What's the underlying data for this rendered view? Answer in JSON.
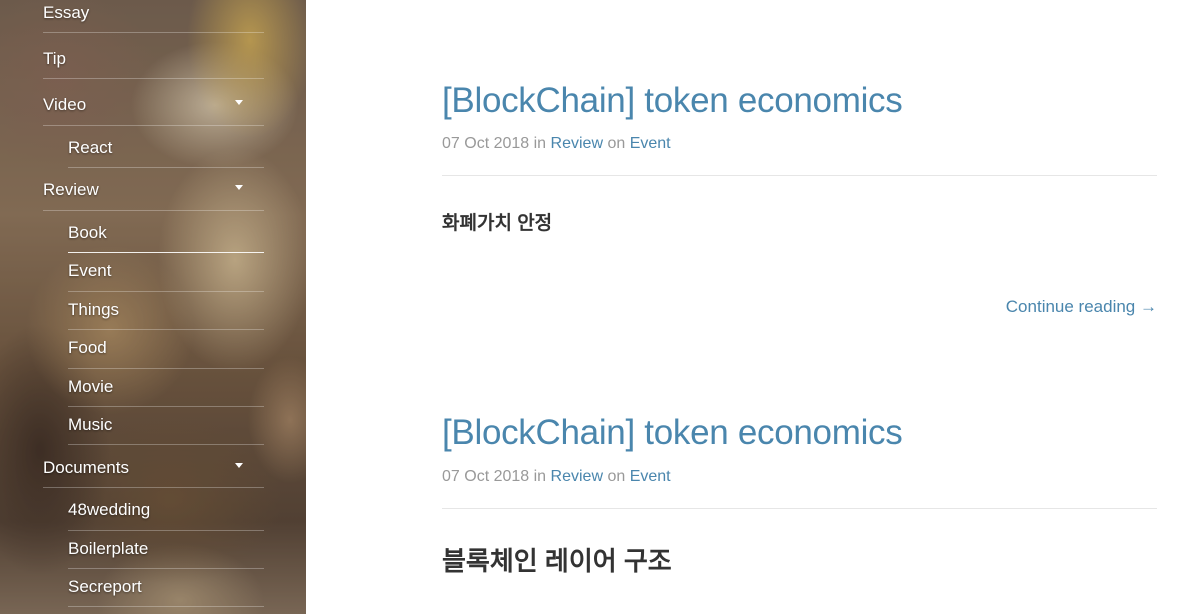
{
  "sidebar": {
    "items": [
      {
        "label": "Essay"
      },
      {
        "label": "Tip"
      },
      {
        "label": "Video"
      },
      {
        "label": "React"
      },
      {
        "label": "Review"
      },
      {
        "label": "Book"
      },
      {
        "label": "Event"
      },
      {
        "label": "Things"
      },
      {
        "label": "Food"
      },
      {
        "label": "Movie"
      },
      {
        "label": "Music"
      },
      {
        "label": "Documents"
      },
      {
        "label": "48wedding"
      },
      {
        "label": "Boilerplate"
      },
      {
        "label": "Secreport"
      }
    ],
    "active_item": "Book",
    "expanded_menus": [
      "Video",
      "Review",
      "Documents"
    ]
  },
  "posts": [
    {
      "title": "[BlockChain] token economics",
      "date": "07 Oct 2018",
      "in_word": "in",
      "category": "Review",
      "on_word": "on",
      "tag": "Event",
      "excerpt": "화폐가치 안정",
      "continue_label": "Continue reading →"
    },
    {
      "title": "[BlockChain] token economics",
      "date": "07 Oct 2018",
      "in_word": "in",
      "category": "Review",
      "on_word": "on",
      "tag": "Event",
      "excerpt": "블록체인 레이어 구조"
    }
  ],
  "colors": {
    "link": "#4a86ad",
    "meta": "#999999",
    "text": "#333333"
  }
}
